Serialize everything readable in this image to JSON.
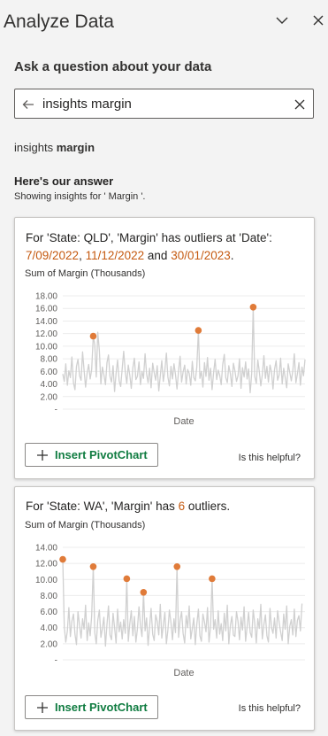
{
  "pane": {
    "title": "Analyze Data"
  },
  "prompt": "Ask a question about your data",
  "search": {
    "value": "insights margin"
  },
  "query_echo": {
    "plain": "insights ",
    "bold": "margin"
  },
  "answer": {
    "heading": "Here's our answer",
    "subtitle": "Showing insights for ' Margin '."
  },
  "colors": {
    "highlight": "#c55a11",
    "outlier": "#e07b39",
    "line": "#d0d0d0",
    "accent_green": "#107c41"
  },
  "cards": [
    {
      "desc_prefix": "For 'State: QLD', 'Margin' has outliers at 'Date':",
      "hl1": "7/09/2022",
      "sep1": ", ",
      "hl2": "11/12/2022",
      "sep2": " and ",
      "hl3": "30/01/2023",
      "suffix": ".",
      "button_label": "Insert PivotChart",
      "helpful_label": "Is this helpful?"
    },
    {
      "desc_prefix": "For 'State: WA', 'Margin' has ",
      "hl1": "6",
      "suffix": " outliers.",
      "button_label": "Insert PivotChart",
      "helpful_label": "Is this helpful?"
    }
  ],
  "chart_data": [
    {
      "type": "line",
      "title": "Sum of Margin (Thousands)",
      "xlabel": "Date",
      "ylabel": "",
      "ylim": [
        0,
        18
      ],
      "y_ticks": [
        "18.00",
        "16.00",
        "14.00",
        "12.00",
        "10.00",
        "8.00",
        "6.00",
        "4.00",
        "2.00",
        "-"
      ],
      "y_tick_values": [
        18,
        16,
        14,
        12,
        10,
        8,
        6,
        4,
        2,
        0
      ],
      "x_count": 160,
      "series": [
        {
          "values": [
            5.6,
            4.4,
            7.2,
            3.8,
            6.1,
            5.0,
            8.3,
            4.2,
            3.1,
            6.8,
            7.9,
            5.3,
            4.6,
            9.1,
            6.2,
            3.5,
            5.8,
            7.1,
            4.8,
            6.3,
            11.6,
            10.2,
            5.1,
            12.2,
            9.3,
            4.0,
            6.7,
            5.5,
            3.9,
            7.4,
            8.6,
            5.2,
            4.3,
            6.9,
            2.8,
            5.7,
            7.8,
            4.5,
            3.6,
            6.4,
            9.2,
            5.9,
            4.1,
            7.0,
            5.4,
            3.3,
            6.6,
            8.1,
            4.7,
            5.2,
            7.5,
            3.9,
            6.0,
            4.9,
            8.8,
            5.6,
            4.2,
            6.5,
            3.4,
            7.3,
            5.8,
            4.6,
            6.9,
            2.9,
            5.3,
            7.7,
            4.4,
            6.2,
            8.9,
            5.1,
            3.7,
            6.8,
            4.8,
            7.2,
            5.5,
            3.2,
            6.1,
            8.4,
            4.3,
            5.9,
            7.0,
            4.0,
            6.3,
            5.7,
            3.8,
            7.6,
            5.0,
            4.5,
            6.7,
            12.5,
            4.9,
            6.0,
            3.5,
            7.4,
            5.2,
            8.2,
            4.6,
            6.5,
            3.1,
            5.8,
            7.9,
            4.7,
            6.2,
            5.4,
            3.9,
            7.1,
            8.7,
            5.0,
            4.2,
            6.9,
            5.6,
            3.6,
            7.3,
            6.1,
            4.4,
            5.3,
            8.0,
            3.3,
            6.6,
            5.1,
            7.5,
            4.8,
            6.4,
            2.6,
            5.7,
            16.2,
            5.2,
            4.1,
            7.8,
            6.0,
            3.7,
            5.5,
            8.5,
            4.9,
            6.8,
            4.3,
            7.0,
            5.9,
            3.2,
            6.3,
            7.7,
            4.6,
            5.4,
            8.1,
            4.0,
            6.5,
            5.0,
            3.4,
            7.2,
            5.8,
            4.5,
            6.1,
            8.8,
            4.2,
            5.6,
            7.4,
            3.8,
            6.7,
            5.3,
            7.9
          ]
        }
      ],
      "outliers": [
        {
          "x": 20,
          "value": 11.6
        },
        {
          "x": 89,
          "value": 12.5
        },
        {
          "x": 125,
          "value": 16.2
        }
      ]
    },
    {
      "type": "line",
      "title": "Sum of Margin (Thousands)",
      "xlabel": "Date",
      "ylabel": "",
      "ylim": [
        0,
        14
      ],
      "y_ticks": [
        "14.00",
        "12.00",
        "10.00",
        "8.00",
        "6.00",
        "4.00",
        "2.00",
        "-"
      ],
      "y_tick_values": [
        14,
        12,
        10,
        8,
        6,
        4,
        2,
        0
      ],
      "x_count": 160,
      "series": [
        {
          "values": [
            12.5,
            4.1,
            2.2,
            3.6,
            6.5,
            2.9,
            4.8,
            5.7,
            3.2,
            1.9,
            6.0,
            4.3,
            2.7,
            5.1,
            3.8,
            6.8,
            2.4,
            4.6,
            3.0,
            5.5,
            11.6,
            3.4,
            2.0,
            4.9,
            6.2,
            2.8,
            3.9,
            5.3,
            1.7,
            4.4,
            6.7,
            3.1,
            2.5,
            5.8,
            4.0,
            2.1,
            6.3,
            3.5,
            4.7,
            2.6,
            5.0,
            3.3,
            10.1,
            2.3,
            4.5,
            6.1,
            3.0,
            5.4,
            2.2,
            3.8,
            6.6,
            4.2,
            2.9,
            8.4,
            3.6,
            5.2,
            1.8,
            4.1,
            6.4,
            3.2,
            2.4,
            5.6,
            4.8,
            3.1,
            6.9,
            2.7,
            4.3,
            5.9,
            2.0,
            3.7,
            6.2,
            4.6,
            2.5,
            5.1,
            3.4,
            11.6,
            2.8,
            4.9,
            6.0,
            3.3,
            2.1,
            5.5,
            4.0,
            6.7,
            2.6,
            3.9,
            5.2,
            1.9,
            4.4,
            6.3,
            3.0,
            2.3,
            5.7,
            4.7,
            3.5,
            6.5,
            2.2,
            4.2,
            10.1,
            3.8,
            5.0,
            2.7,
            6.1,
            3.2,
            4.5,
            2.4,
            5.8,
            3.6,
            6.8,
            2.0,
            4.3,
            5.4,
            3.1,
            2.9,
            6.0,
            4.8,
            2.5,
            5.3,
            3.7,
            6.6,
            2.3,
            4.1,
            5.9,
            3.4,
            2.8,
            6.2,
            4.6,
            2.1,
            5.1,
            3.9,
            6.9,
            2.6,
            4.4,
            5.6,
            3.0,
            2.2,
            6.4,
            4.0,
            3.3,
            5.2,
            2.7,
            6.1,
            4.7,
            3.5,
            2.4,
            5.7,
            3.8,
            6.7,
            2.0,
            4.2,
            5.0,
            3.1,
            6.3,
            2.9,
            4.9,
            5.5,
            3.6,
            7.0
          ]
        }
      ],
      "outliers": [
        {
          "x": 0,
          "value": 12.5
        },
        {
          "x": 20,
          "value": 11.6
        },
        {
          "x": 42,
          "value": 10.1
        },
        {
          "x": 53,
          "value": 8.4
        },
        {
          "x": 75,
          "value": 11.6
        },
        {
          "x": 98,
          "value": 10.1
        }
      ]
    }
  ]
}
